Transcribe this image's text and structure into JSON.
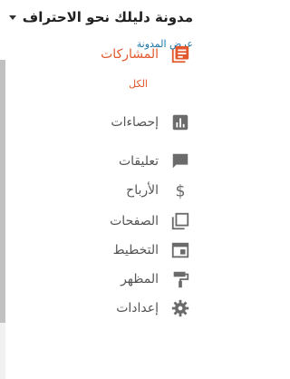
{
  "header": {
    "blog_title": "مدونة دليلك نحو الاحتراف",
    "view_blog_label": "عرض المدونة"
  },
  "nav": {
    "posts_label": "المشاركات",
    "posts_all_label": "الكل",
    "stats_label": "إحصاءات",
    "comments_label": "تعليقات",
    "earnings_label": "الأرباح",
    "pages_label": "الصفحات",
    "layout_label": "التخطيط",
    "theme_label": "المظهر",
    "settings_label": "إعدادات"
  },
  "colors": {
    "accent": "#e2572b",
    "link": "#1a73a8",
    "icon": "#6b6b6b"
  }
}
